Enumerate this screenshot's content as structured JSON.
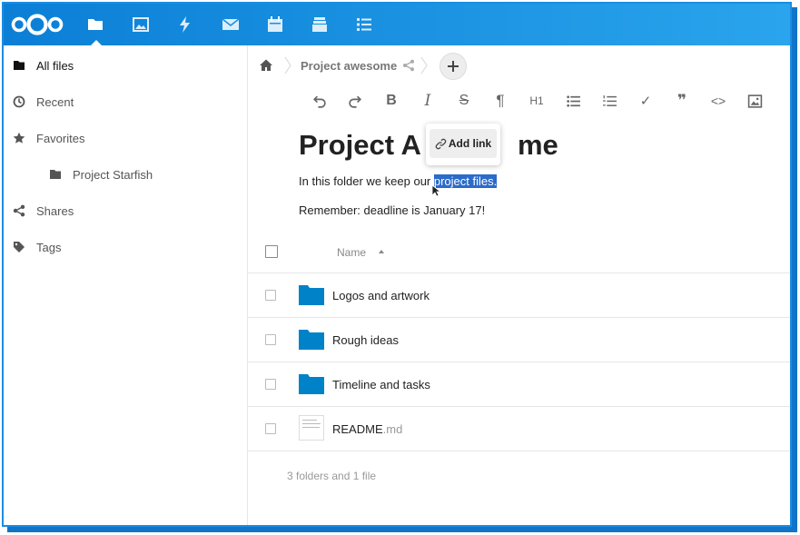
{
  "topbar": {
    "apps": [
      {
        "name": "files",
        "icon": "folder-icon",
        "active": true
      },
      {
        "name": "photos",
        "icon": "image-icon"
      },
      {
        "name": "activity",
        "icon": "lightning-icon"
      },
      {
        "name": "mail",
        "icon": "mail-icon"
      },
      {
        "name": "calendar",
        "icon": "calendar-icon"
      },
      {
        "name": "deck",
        "icon": "archive-icon"
      },
      {
        "name": "tasks",
        "icon": "list-icon"
      }
    ],
    "background": "#0b7fd6"
  },
  "sidebar": {
    "items": [
      {
        "label": "All files",
        "icon": "folder-icon"
      },
      {
        "label": "Recent",
        "icon": "clock-icon"
      },
      {
        "label": "Favorites",
        "icon": "star-icon"
      },
      {
        "label": "Project Starfish",
        "icon": "folder-icon"
      },
      {
        "label": "Shares",
        "icon": "share-icon"
      },
      {
        "label": "Tags",
        "icon": "tag-icon"
      }
    ]
  },
  "breadcrumb": {
    "current": "Project awesome"
  },
  "editor": {
    "toolbar": [
      {
        "name": "undo",
        "icon": "undo-icon"
      },
      {
        "name": "redo",
        "icon": "redo-icon"
      },
      {
        "name": "bold",
        "glyph": "B"
      },
      {
        "name": "italic",
        "glyph": "I"
      },
      {
        "name": "strikethrough",
        "glyph": "S"
      },
      {
        "name": "paragraph",
        "glyph": "¶"
      },
      {
        "name": "heading",
        "glyph": "H1"
      },
      {
        "name": "bullet-list",
        "icon": "bullet-list-icon"
      },
      {
        "name": "ordered-list",
        "icon": "ordered-list-icon"
      },
      {
        "name": "checkbox",
        "glyph": "✓"
      },
      {
        "name": "quote",
        "glyph": "❞"
      },
      {
        "name": "code",
        "glyph": "<>"
      },
      {
        "name": "image",
        "icon": "image-icon"
      }
    ],
    "title_before": "Project A",
    "title_after": "me",
    "para1_before": "In this folder we keep our ",
    "para1_selected": "project files.",
    "para2": "Remember: deadline is January 17!",
    "popover_label": "Add link",
    "selection_color": "#2b6bc9"
  },
  "files": {
    "column_name": "Name",
    "rows": [
      {
        "name": "Logos and artwork",
        "ext": "",
        "type": "folder"
      },
      {
        "name": "Rough ideas",
        "ext": "",
        "type": "folder"
      },
      {
        "name": "Timeline and tasks",
        "ext": "",
        "type": "folder"
      },
      {
        "name": "README",
        "ext": ".md",
        "type": "file"
      }
    ],
    "summary": "3 folders and 1 file",
    "folder_color": "#0082c9"
  }
}
